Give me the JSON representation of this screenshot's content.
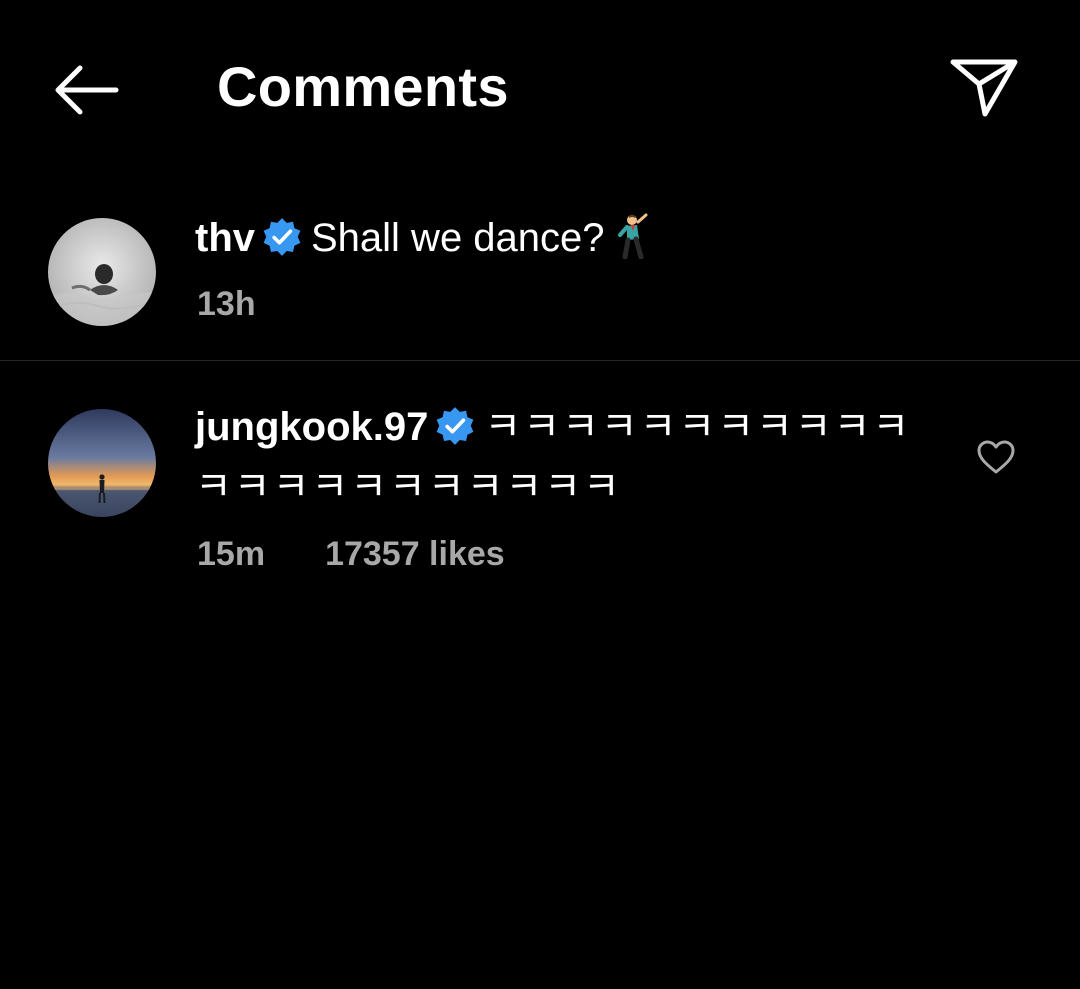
{
  "header": {
    "title": "Comments",
    "back_icon": "arrow-left-icon",
    "share_icon": "paper-plane-icon"
  },
  "caption": {
    "username": "thv",
    "verified": true,
    "text": "Shall we dance?",
    "emoji": "man-dancing-emoji",
    "time": "13h"
  },
  "comments": [
    {
      "username": "jungkook.97",
      "verified": true,
      "text_line1": "ㅋㅋㅋㅋㅋㅋㅋㅋㅋㅋㅋ",
      "text_line2": "ㅋㅋㅋㅋㅋㅋㅋㅋㅋㅋㅋ",
      "time": "15m",
      "likes": "17357 likes",
      "like_icon": "heart-outline-icon"
    }
  ],
  "colors": {
    "background": "#000000",
    "text": "#ffffff",
    "meta": "#a8a8a8",
    "verified_badge": "#3897f0",
    "divider": "#262626"
  }
}
